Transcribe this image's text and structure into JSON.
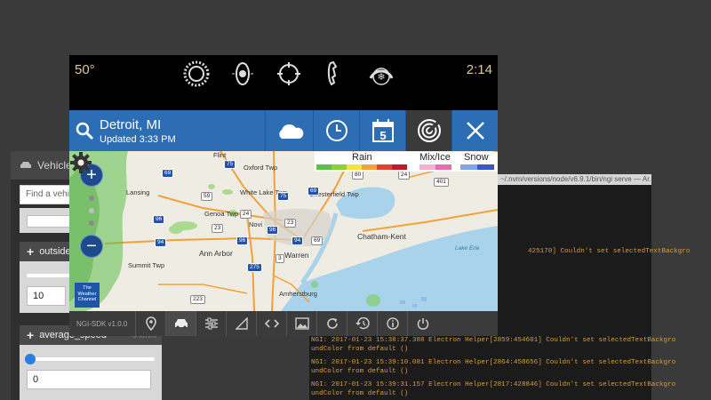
{
  "vehicle_panel": {
    "title": "Vehicle",
    "search_placeholder": "Find a vehicle",
    "cards": [
      {
        "label": "outside_air_temperature",
        "value": "10"
      },
      {
        "label": "average_speed",
        "hint": "0 km/h",
        "value": "0"
      }
    ]
  },
  "console": {
    "title": "~/.nvm/versions/node/v6.9.1/bin/ngi serve — Ar...",
    "lines": [
      "425170] Couldn't set selectedTextBackgro",
      "NGI: 2017-01-23 15:38:37.388 Electron Helper[2859:454601] Couldn't set selectedTextBackgro",
      "undColor from default ()",
      "NGI: 2017-01-23 15:39:10.081 Electron Helper[2864:458656] Couldn't set selectedTextBackgro",
      "undColor from default ()",
      "NGI: 2017-01-23 15:39:31.157 Electron Helper[2817:428846] Couldn't set selectedTextBackgro",
      "undColor from default ()"
    ]
  },
  "head_unit": {
    "temperature": "50°",
    "clock": "2:14",
    "top_icons": [
      "sun-icon",
      "media-icon",
      "navigation-icon",
      "phone-icon",
      "climate-icon"
    ],
    "weather": {
      "city": "Detroit, MI",
      "updated": "Updated 3:33 PM",
      "calendar_day": "5",
      "tabs": [
        "cloud-icon",
        "clock-icon",
        "calendar-icon",
        "radar-icon",
        "close-icon"
      ]
    },
    "legend": {
      "rain": "Rain",
      "mix": "Mix/Ice",
      "snow": "Snow",
      "rain_colors": [
        "#5cc04a",
        "#8cd13a",
        "#f1e43a",
        "#f2a23a",
        "#e8422e",
        "#c21a2c"
      ],
      "mix_colors": [
        "#f3b2d4",
        "#e56fb3"
      ],
      "snow_colors": [
        "#7ea6e8",
        "#3a57c6"
      ]
    },
    "map_labels": [
      "Flint",
      "Oxford Twp",
      "Lansing",
      "White Lake Twp",
      "Chesterfield Twp",
      "Genoa Twp",
      "Novi",
      "Ann Arbor",
      "Warren",
      "Chatham-Kent",
      "Summit Twp",
      "Amherstburg",
      "Lake Erie"
    ],
    "shields": [
      "75",
      "69",
      "96",
      "94",
      "23",
      "275",
      "69",
      "75",
      "80",
      "24",
      "401",
      "3",
      "223",
      "59",
      "96",
      "96",
      "94",
      "69",
      "23",
      "24"
    ],
    "twc": "The Weather Channel",
    "sdk_version": "NGI-SDK v1.0.0",
    "bottom_icons": [
      "location-pin-icon",
      "car-icon",
      "settings-sliders-icon",
      "signal-icon",
      "code-icon",
      "image-icon",
      "refresh-icon",
      "history-icon",
      "info-icon",
      "power-icon"
    ]
  }
}
